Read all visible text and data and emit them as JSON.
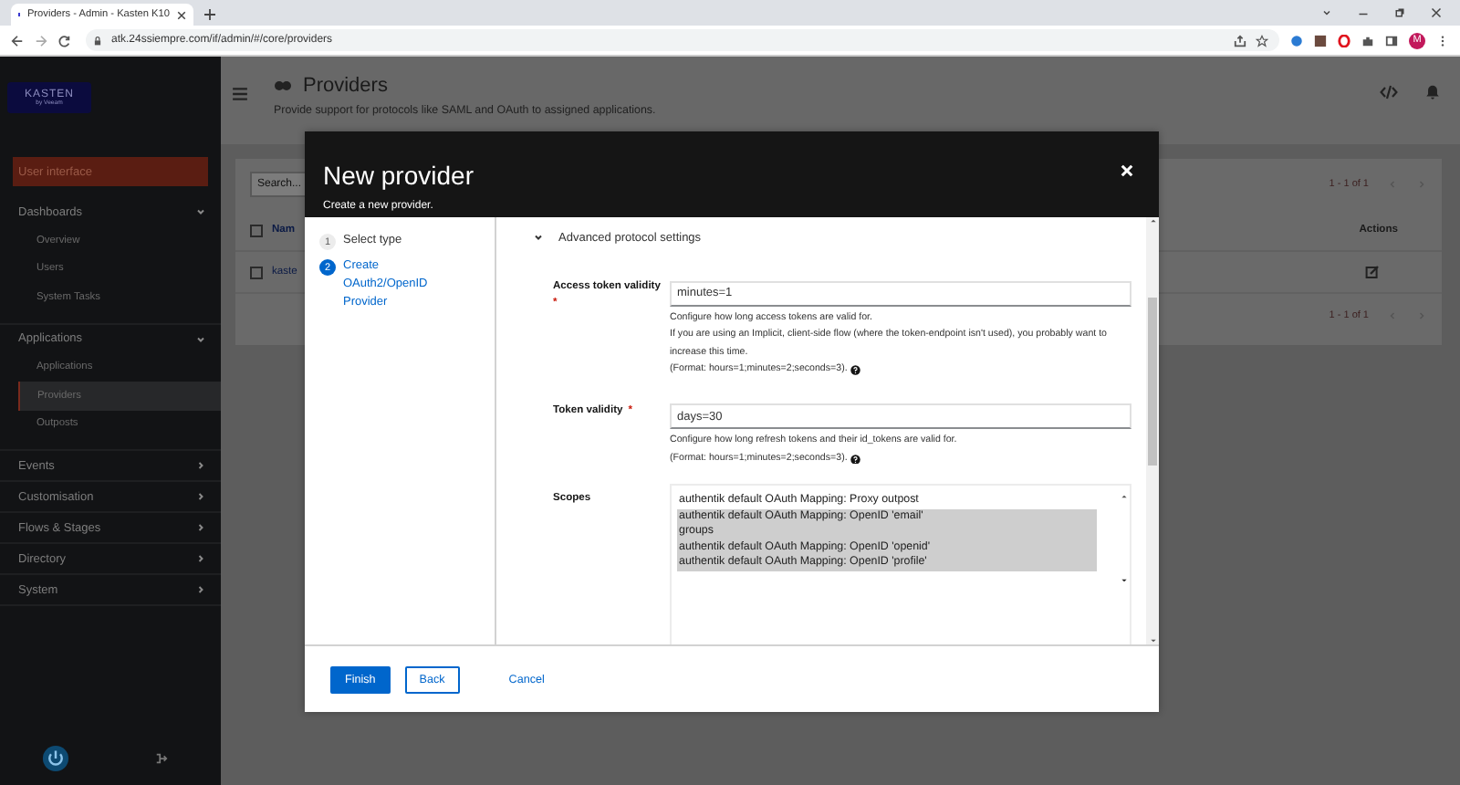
{
  "browser": {
    "tab_title": "Providers - Admin - Kasten K10",
    "url": "atk.24ssiempre.com/if/admin/#/core/providers",
    "avatar": "M"
  },
  "sidebar": {
    "logo_text": "KASTEN",
    "logo_sub": "by Veeam",
    "top_item": "User interface",
    "groups": [
      {
        "label": "Dashboards",
        "expanded": true,
        "items": [
          {
            "label": "Overview",
            "selected": false
          },
          {
            "label": "Users",
            "selected": false
          },
          {
            "label": "System Tasks",
            "selected": false
          }
        ]
      },
      {
        "label": "Applications",
        "expanded": true,
        "items": [
          {
            "label": "Applications",
            "selected": false
          },
          {
            "label": "Providers",
            "selected": true
          },
          {
            "label": "Outposts",
            "selected": false
          }
        ]
      },
      {
        "label": "Events",
        "expanded": false
      },
      {
        "label": "Customisation",
        "expanded": false
      },
      {
        "label": "Flows & Stages",
        "expanded": false
      },
      {
        "label": "Directory",
        "expanded": false
      },
      {
        "label": "System",
        "expanded": false
      }
    ]
  },
  "page": {
    "title": "Providers",
    "description": "Provide support for protocols like SAML and OAuth to assigned applications.",
    "search_placeholder": "Search...",
    "pagination_top": "1 - 1 of 1",
    "pagination_bottom": "1 - 1 of 1",
    "select_all_checked": false,
    "columns": [
      "Nam",
      "Actions"
    ],
    "rows": [
      {
        "name": "kaste",
        "checked": false
      }
    ]
  },
  "modal": {
    "title": "New provider",
    "subtitle": "Create a new provider.",
    "steps": [
      {
        "number": "1",
        "label": "Select type",
        "selected": false
      },
      {
        "number": "2",
        "label": "Create OAuth2/OpenID Provider",
        "selected": true
      }
    ],
    "section": {
      "label": "Advanced protocol settings",
      "expanded": true
    },
    "fields": [
      {
        "label": "Access token validity",
        "required_mark": "*",
        "value": "minutes=1",
        "help": [
          {
            "text": "Configure how long access tokens are valid for.",
            "info": false
          },
          {
            "text": "If you are using an Implicit, client-side flow (where the token-endpoint isn't used), you probably want to increase this time.",
            "info": false
          },
          {
            "text": "(Format: hours=1;minutes=2;seconds=3).",
            "info": true
          }
        ]
      },
      {
        "label": "Token validity",
        "required_mark": "*",
        "value": "days=30",
        "help": [
          {
            "text": "Configure how long refresh tokens and their id_tokens are valid for.",
            "info": false
          },
          {
            "text": "(Format: hours=1;minutes=2;seconds=3).",
            "info": true
          }
        ]
      }
    ],
    "scopes": {
      "label": "Scopes",
      "options": [
        {
          "label": "authentik default OAuth Mapping: Proxy outpost",
          "selected": false
        },
        {
          "label": "authentik default OAuth Mapping: OpenID 'email'",
          "selected": true
        },
        {
          "label": "groups",
          "selected": true
        },
        {
          "label": "authentik default OAuth Mapping: OpenID 'openid'",
          "selected": true
        },
        {
          "label": "authentik default OAuth Mapping: OpenID 'profile'",
          "selected": true
        }
      ]
    },
    "buttons": {
      "finish": "Finish",
      "back": "Back",
      "cancel": "Cancel"
    }
  }
}
